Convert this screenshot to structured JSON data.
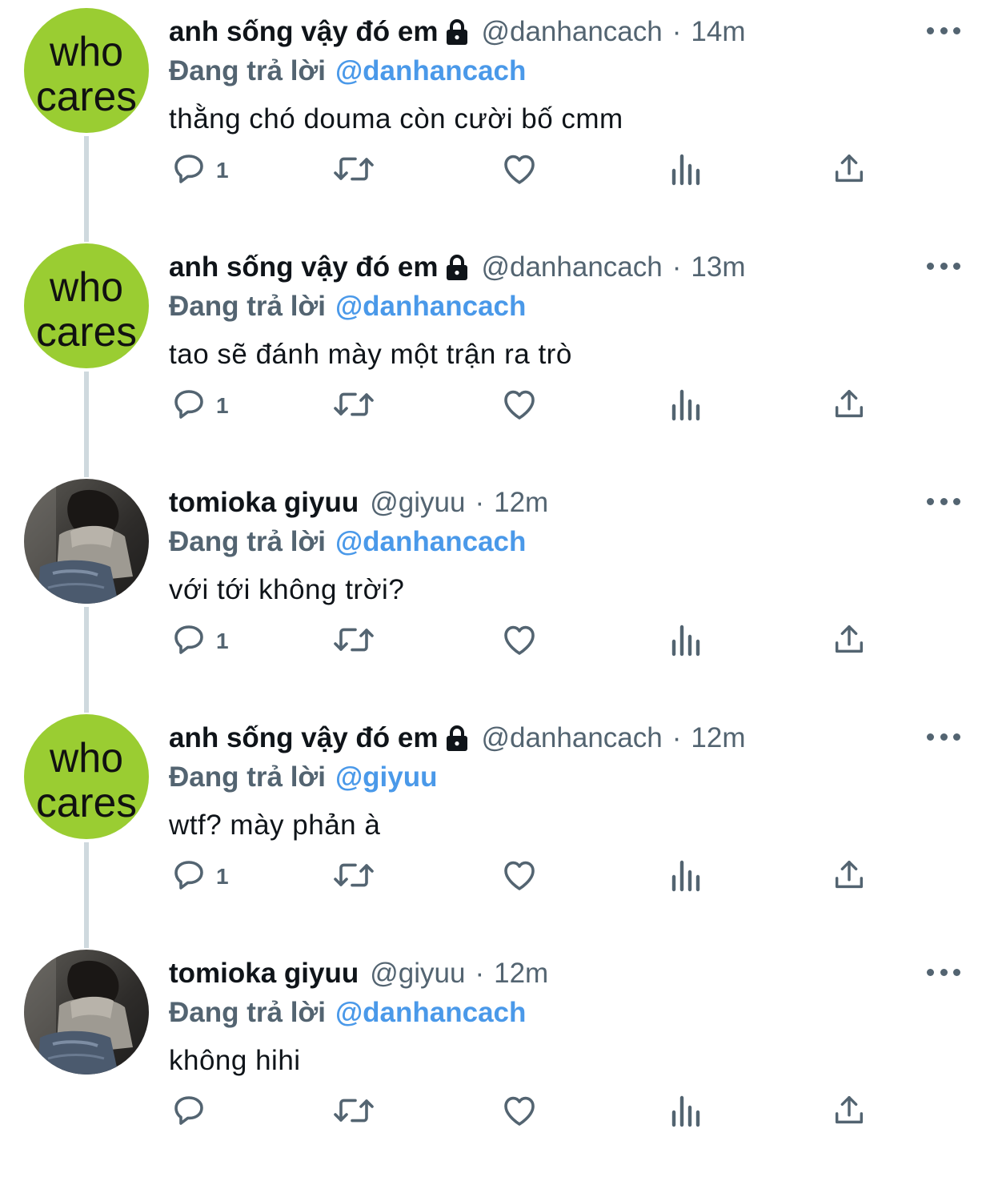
{
  "tweets": [
    {
      "author": "anh sống vậy đó em",
      "locked": true,
      "handle": "@danhancach",
      "time": "14m",
      "reply_label": "Đang trả lời",
      "reply_to": "@danhancach",
      "text": "thằng chó douma còn cười bố cmm",
      "reply_count": "1",
      "avatar": "who-cares",
      "thread_below": true
    },
    {
      "author": "anh sống vậy đó em",
      "locked": true,
      "handle": "@danhancach",
      "time": "13m",
      "reply_label": "Đang trả lời",
      "reply_to": "@danhancach",
      "text": "tao sẽ đánh mày một trận ra trò",
      "reply_count": "1",
      "avatar": "who-cares",
      "thread_below": true
    },
    {
      "author": "tomioka giyuu",
      "locked": false,
      "handle": "@giyuu",
      "time": "12m",
      "reply_label": "Đang trả lời",
      "reply_to": "@danhancach",
      "text": "với tới không trời?",
      "reply_count": "1",
      "avatar": "photo",
      "thread_below": true
    },
    {
      "author": "anh sống vậy đó em",
      "locked": true,
      "handle": "@danhancach",
      "time": "12m",
      "reply_label": "Đang trả lời",
      "reply_to": "@giyuu",
      "text": "wtf? mày phản à",
      "reply_count": "1",
      "avatar": "who-cares",
      "thread_below": true
    },
    {
      "author": "tomioka giyuu",
      "locked": false,
      "handle": "@giyuu",
      "time": "12m",
      "reply_label": "Đang trả lời",
      "reply_to": "@danhancach",
      "text": "không hihi",
      "reply_count": "",
      "avatar": "photo",
      "thread_below": false
    }
  ],
  "avatar_text": {
    "line1": "who",
    "line2": "cares"
  },
  "dot_separator": "·",
  "colors": {
    "text": "#0f1419",
    "secondary": "#536471",
    "link": "#4a99e9",
    "thread_line": "#cfd9de",
    "avatar_green": "#9acd32"
  },
  "icons": [
    "lock-icon",
    "more-icon",
    "reply-icon",
    "retweet-icon",
    "like-icon",
    "analytics-icon",
    "share-icon"
  ]
}
